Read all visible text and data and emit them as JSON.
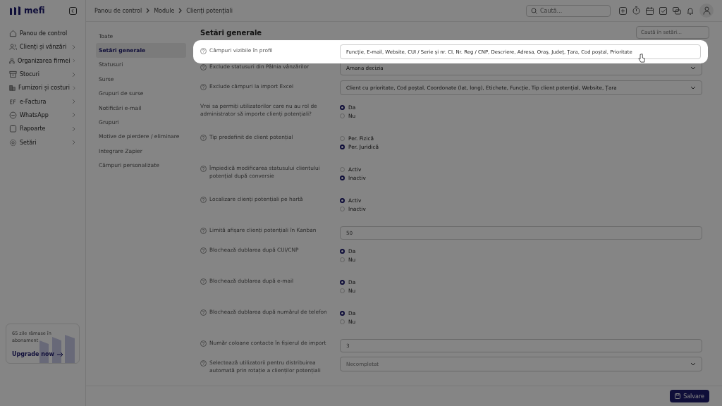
{
  "brand": {
    "name": "mefi"
  },
  "sidebar": {
    "items": [
      {
        "label": "Panou de control",
        "has_submenu": false
      },
      {
        "label": "Clienți și vânzări",
        "has_submenu": true
      },
      {
        "label": "Organizarea firmei",
        "has_submenu": true
      },
      {
        "label": "Stocuri",
        "has_submenu": true
      },
      {
        "label": "Furnizori și costuri",
        "has_submenu": true
      },
      {
        "label": "e-Factura",
        "has_submenu": true
      },
      {
        "label": "WhatsApp",
        "has_submenu": true
      },
      {
        "label": "Rapoarte",
        "has_submenu": true
      },
      {
        "label": "Setări",
        "has_submenu": true
      }
    ],
    "promo": {
      "text": "65 zile rămase în abonament",
      "link": "Upgrade now"
    }
  },
  "breadcrumb": [
    "Panou de control",
    "Module",
    "Clienți potențiali"
  ],
  "search": {
    "placeholder": "Caută..."
  },
  "subnav": [
    {
      "label": "Toate",
      "selected": false
    },
    {
      "label": "Setări generale",
      "selected": true
    },
    {
      "label": "Statusuri",
      "selected": false
    },
    {
      "label": "Surse",
      "selected": false
    },
    {
      "label": "Grupuri de surse",
      "selected": false
    },
    {
      "label": "Notificări e-mail",
      "selected": false
    },
    {
      "label": "Grupuri",
      "selected": false
    },
    {
      "label": "Motive de pierdere / eliminare",
      "selected": false
    },
    {
      "label": "Integrare Zapier",
      "selected": false
    },
    {
      "label": "Câmpuri personalizate",
      "selected": false
    }
  ],
  "section": {
    "title": "Setări generale",
    "search_placeholder": "Caută în setări..."
  },
  "settings": [
    {
      "kind": "select",
      "label": "Câmpuri vizibile în profil",
      "help": true,
      "highlighted": true,
      "value": "Funcție, E-mail, Website, CUI / Serie și nr. CI, Nr. Reg / CNP, Descriere, Adresa, Oraș, Județ, Țara, Cod poștal, Prioritate"
    },
    {
      "kind": "select",
      "label": "Exclude statusuri din Pâlnia vânzărilor",
      "help": true,
      "highlighted": false,
      "value": "Amana decizia"
    },
    {
      "kind": "select",
      "label": "Exclude câmpuri la import Excel",
      "help": true,
      "highlighted": false,
      "value": "Client cu prioritate, Cod poștal, Coordonate (lat, long), Etichete, Funcție, Tip client potențial, Website, Țara"
    },
    {
      "kind": "radio",
      "label": "Vrei sa permiți utilizatorilor care nu au rol de administrator să importe clienți potențiali?",
      "help": false,
      "highlighted": false,
      "options": [
        {
          "label": "Da",
          "selected": true
        },
        {
          "label": "Nu",
          "selected": false
        }
      ]
    },
    {
      "kind": "radio",
      "label": "Tip predefinit de client potențial",
      "help": true,
      "highlighted": false,
      "options": [
        {
          "label": "Per. Fizică",
          "selected": false
        },
        {
          "label": "Per. Juridică",
          "selected": true
        }
      ]
    },
    {
      "kind": "radio",
      "label": "Împiedică modificarea statusului clientului potențial după conversie",
      "help": true,
      "highlighted": false,
      "options": [
        {
          "label": "Activ",
          "selected": false
        },
        {
          "label": "Inactiv",
          "selected": true
        }
      ]
    },
    {
      "kind": "radio",
      "label": "Localizare clienți potențiali pe hartă",
      "help": true,
      "highlighted": false,
      "options": [
        {
          "label": "Activ",
          "selected": true
        },
        {
          "label": "Inactiv",
          "selected": false
        }
      ]
    },
    {
      "kind": "input",
      "label": "Limită afișare clienți potențiali în Kanban",
      "help": true,
      "highlighted": false,
      "value": "50"
    },
    {
      "kind": "radio",
      "label": "Blochează dublarea după CUI/CNP",
      "help": true,
      "highlighted": false,
      "options": [
        {
          "label": "Da",
          "selected": true
        },
        {
          "label": "Nu",
          "selected": false
        }
      ]
    },
    {
      "kind": "radio",
      "label": "Blochează dublarea după e-mail",
      "help": true,
      "highlighted": false,
      "options": [
        {
          "label": "Da",
          "selected": true
        },
        {
          "label": "Nu",
          "selected": false
        }
      ]
    },
    {
      "kind": "radio",
      "label": "Blochează dublarea după numărul de telefon",
      "help": true,
      "highlighted": false,
      "options": [
        {
          "label": "Da",
          "selected": true
        },
        {
          "label": "Nu",
          "selected": false
        }
      ]
    },
    {
      "kind": "input",
      "label": "Număr coloane contacte în fișierul de import",
      "help": true,
      "highlighted": false,
      "value": "3"
    },
    {
      "kind": "select",
      "label": "Selectează utilizatorii pentru distribuirea automată prin rotație a clienților potențiali",
      "help": true,
      "highlighted": false,
      "placeholder": "Necompletat"
    }
  ],
  "save_button": "Salvare"
}
